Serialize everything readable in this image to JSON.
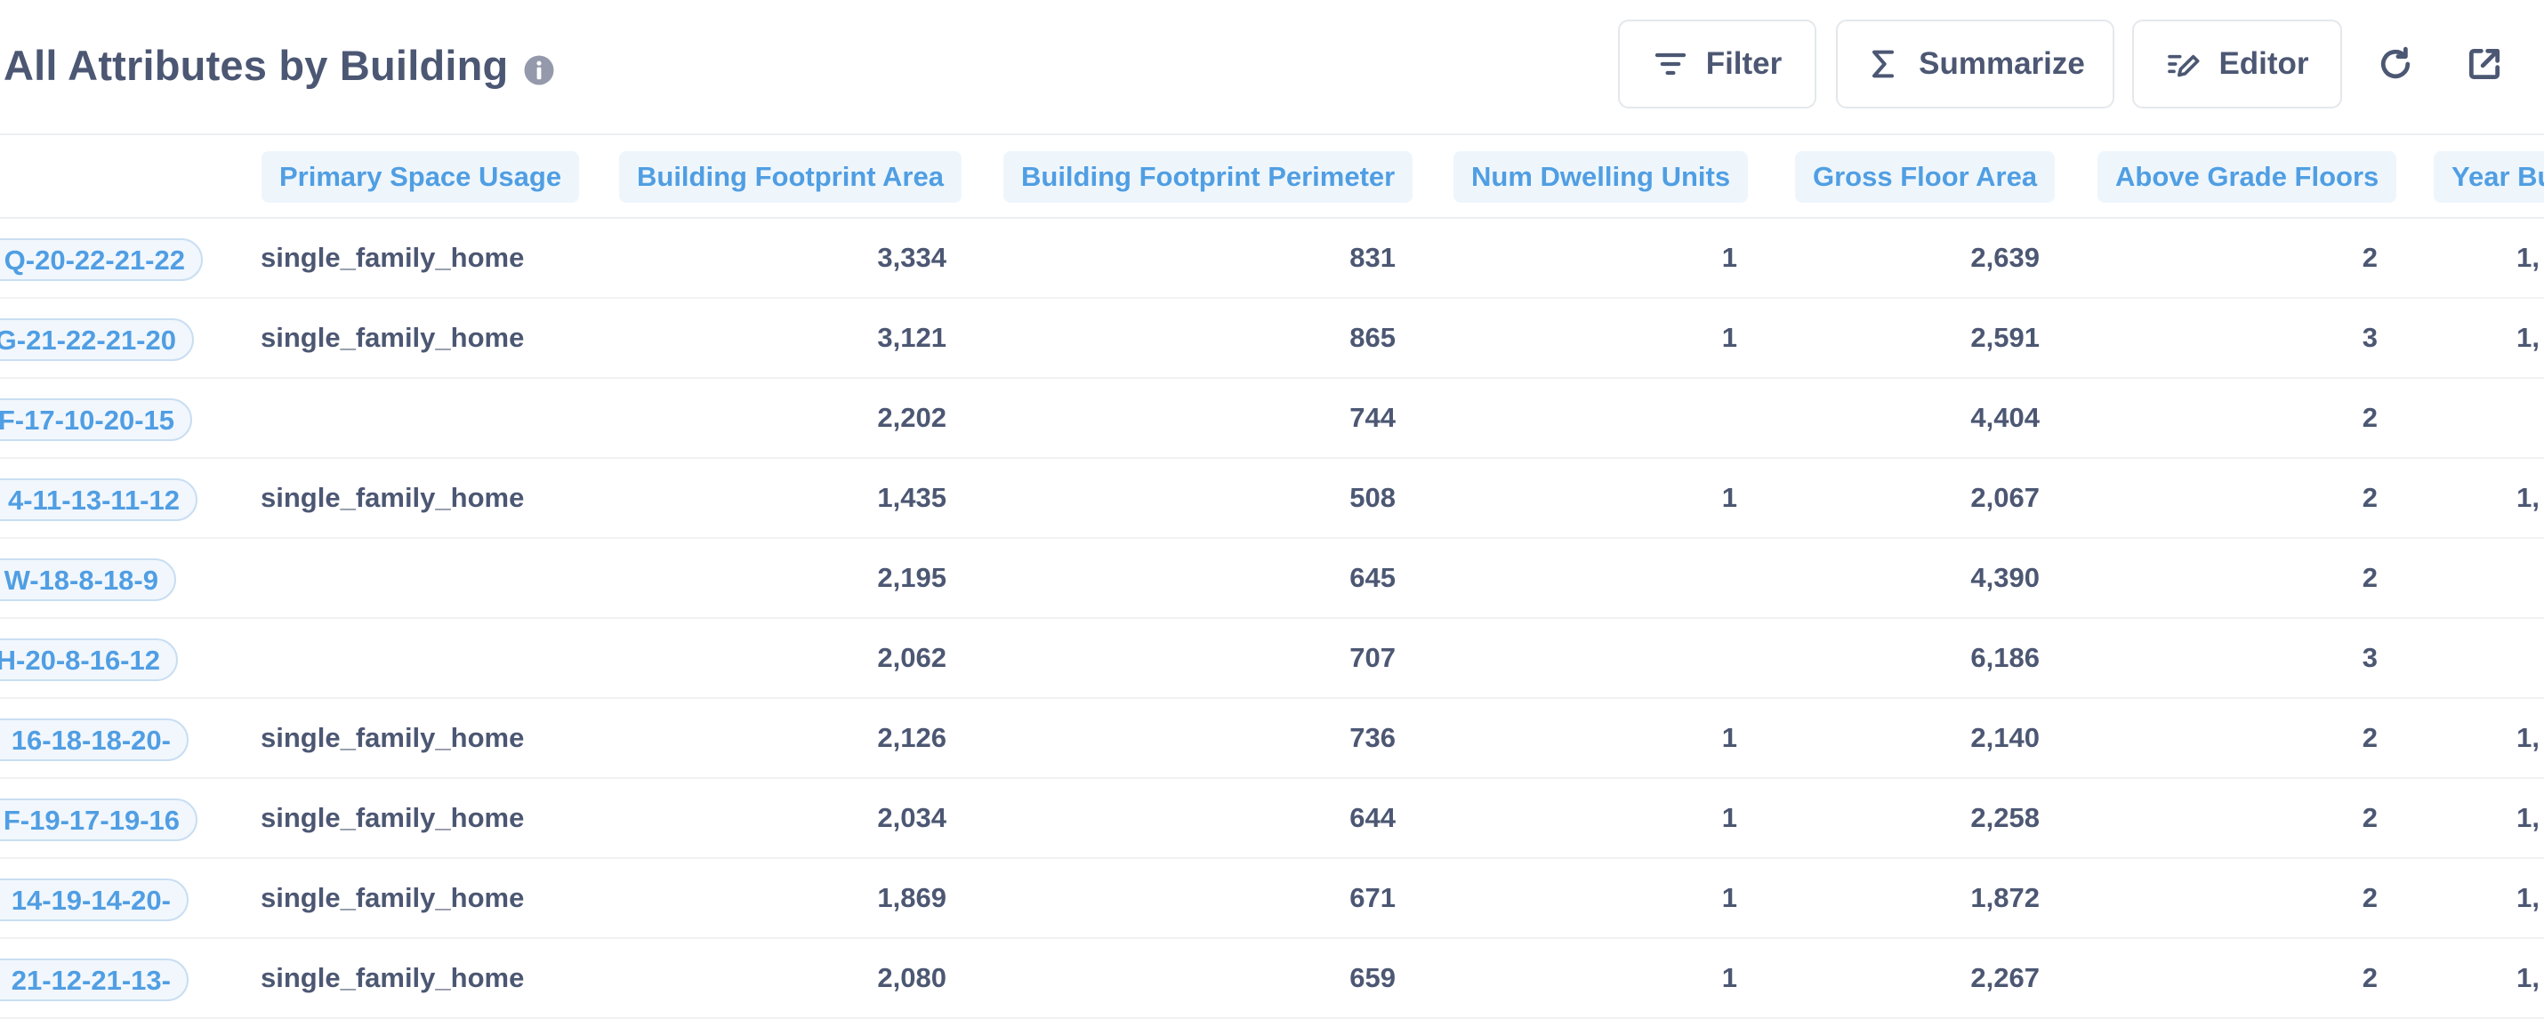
{
  "header": {
    "title": "All Attributes by Building",
    "filter_label": "Filter",
    "summarize_label": "Summarize",
    "editor_label": "Editor"
  },
  "table": {
    "columns": [
      "Primary Space Usage",
      "Building Footprint Area",
      "Building Footprint Perimeter",
      "Num Dwelling Units",
      "Gross Floor Area",
      "Above Grade Floors",
      "Year Bu"
    ],
    "rows": [
      {
        "id": "Q-20-22-21-22",
        "usage": "single_family_home",
        "footprint_area": "3,334",
        "perimeter": "831",
        "dwelling_units": "1",
        "gross_floor_area": "2,639",
        "floors": "2",
        "year": "1,"
      },
      {
        "id": "G-21-22-21-20",
        "usage": "single_family_home",
        "footprint_area": "3,121",
        "perimeter": "865",
        "dwelling_units": "1",
        "gross_floor_area": "2,591",
        "floors": "3",
        "year": "1,"
      },
      {
        "id": "F-17-10-20-15",
        "usage": "",
        "footprint_area": "2,202",
        "perimeter": "744",
        "dwelling_units": "",
        "gross_floor_area": "4,404",
        "floors": "2",
        "year": ""
      },
      {
        "id": "4-11-13-11-12",
        "usage": "single_family_home",
        "footprint_area": "1,435",
        "perimeter": "508",
        "dwelling_units": "1",
        "gross_floor_area": "2,067",
        "floors": "2",
        "year": "1,"
      },
      {
        "id": "W-18-8-18-9",
        "usage": "",
        "footprint_area": "2,195",
        "perimeter": "645",
        "dwelling_units": "",
        "gross_floor_area": "4,390",
        "floors": "2",
        "year": ""
      },
      {
        "id": "H-20-8-16-12",
        "usage": "",
        "footprint_area": "2,062",
        "perimeter": "707",
        "dwelling_units": "",
        "gross_floor_area": "6,186",
        "floors": "3",
        "year": ""
      },
      {
        "id": "-16-18-18-20",
        "usage": "single_family_home",
        "footprint_area": "2,126",
        "perimeter": "736",
        "dwelling_units": "1",
        "gross_floor_area": "2,140",
        "floors": "2",
        "year": "1,"
      },
      {
        "id": "F-19-17-19-16",
        "usage": "single_family_home",
        "footprint_area": "2,034",
        "perimeter": "644",
        "dwelling_units": "1",
        "gross_floor_area": "2,258",
        "floors": "2",
        "year": "1,"
      },
      {
        "id": "-14-19-14-20",
        "usage": "single_family_home",
        "footprint_area": "1,869",
        "perimeter": "671",
        "dwelling_units": "1",
        "gross_floor_area": "1,872",
        "floors": "2",
        "year": "1,"
      },
      {
        "id": "-21-12-21-13",
        "usage": "single_family_home",
        "footprint_area": "2,080",
        "perimeter": "659",
        "dwelling_units": "1",
        "gross_floor_area": "2,267",
        "floors": "2",
        "year": "1,"
      }
    ]
  }
}
